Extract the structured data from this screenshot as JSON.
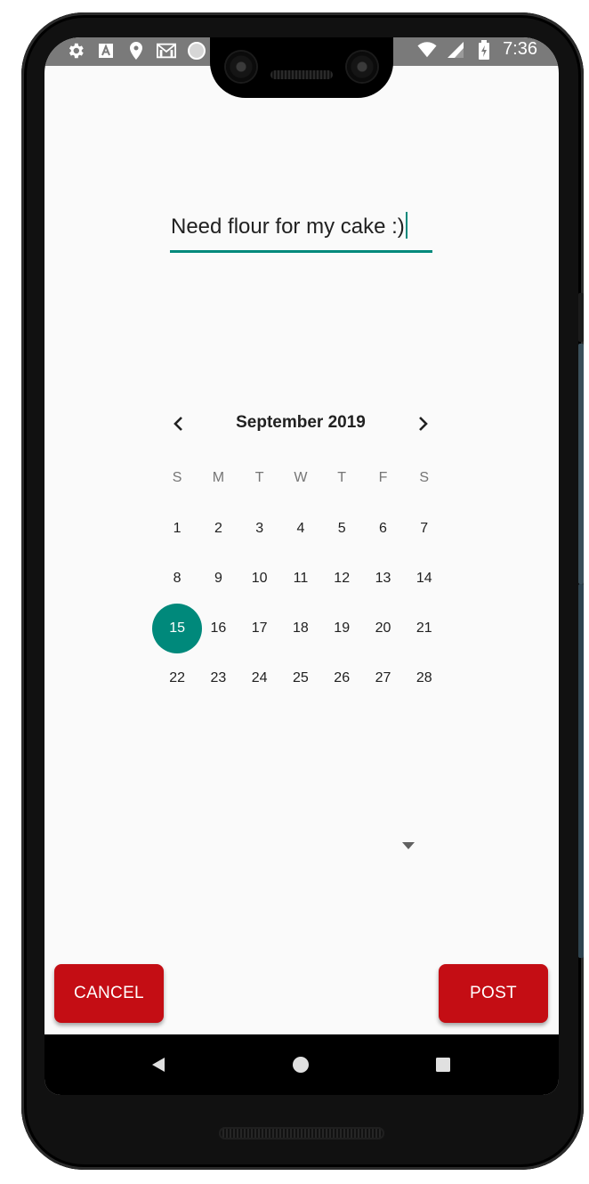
{
  "status_bar": {
    "time": "7:36",
    "left_icons": [
      "settings-gear-icon",
      "accessibility-a-icon",
      "location-pin-icon",
      "gmail-icon",
      "circle-status-icon"
    ],
    "right_icons": [
      "wifi-icon",
      "cell-signal-icon",
      "battery-charging-icon"
    ]
  },
  "text_field": {
    "value": "Need flour for my cake :)"
  },
  "calendar": {
    "month_label": "September 2019",
    "prev_icon": "chevron-left-icon",
    "next_icon": "chevron-right-icon",
    "weekdays": [
      "S",
      "M",
      "T",
      "W",
      "T",
      "F",
      "S"
    ],
    "weeks": [
      [
        "1",
        "2",
        "3",
        "4",
        "5",
        "6",
        "7"
      ],
      [
        "8",
        "9",
        "10",
        "11",
        "12",
        "13",
        "14"
      ],
      [
        "15",
        "16",
        "17",
        "18",
        "19",
        "20",
        "21"
      ],
      [
        "22",
        "23",
        "24",
        "25",
        "26",
        "27",
        "28"
      ]
    ],
    "selected_day": "15"
  },
  "dropdown": {
    "icon": "dropdown-arrow-icon"
  },
  "actions": {
    "cancel_label": "CANCEL",
    "post_label": "POST"
  },
  "colors": {
    "accent": "#00897b",
    "button": "#c40d14"
  }
}
